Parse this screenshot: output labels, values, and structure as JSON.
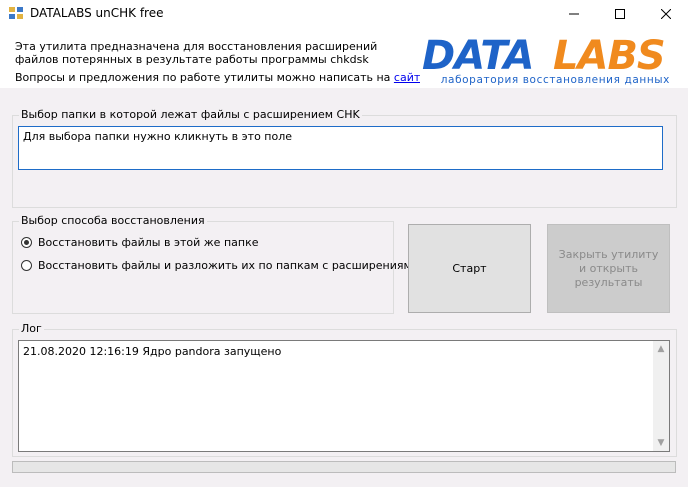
{
  "window": {
    "title": "DATALABS unCHK free"
  },
  "header": {
    "description": "Эта утилита предназначена для восстановления расширений файлов потерянных в результате работы программы chkdsk",
    "contact_text": "Вопросы и предложения по работе утилиты можно написать на",
    "contact_link": "сайте",
    "logo": {
      "part1": "DATA",
      "part2": "LABS",
      "tagline": "лаборатория восстановления данных",
      "color_blue": "#1e63c8",
      "color_orange": "#f08a1e"
    }
  },
  "folder_group": {
    "label": "Выбор папки в которой лежат файлы с расширением CHK",
    "field_text": "Для выбора папки нужно кликнуть в это поле"
  },
  "method_group": {
    "label": "Выбор способа восстановления",
    "options": [
      {
        "label": "Восстановить файлы в этой же папке",
        "checked": true
      },
      {
        "label": "Восстановить файлы и разложить их  по папкам с расширениями",
        "checked": false
      }
    ]
  },
  "buttons": {
    "start": "Старт",
    "close_open": "Закрыть утилиту и открыть результаты"
  },
  "log_group": {
    "label": "Лог",
    "lines": [
      "21.08.2020 12:16:19 Ядро pandora запущено"
    ]
  },
  "progress": {
    "value": 0
  },
  "icons": {
    "app": "app-icon",
    "minimize": "minimize-icon",
    "maximize": "maximize-icon",
    "close": "close-icon",
    "scroll_up": "scroll-up-icon",
    "scroll_down": "scroll-down-icon"
  }
}
